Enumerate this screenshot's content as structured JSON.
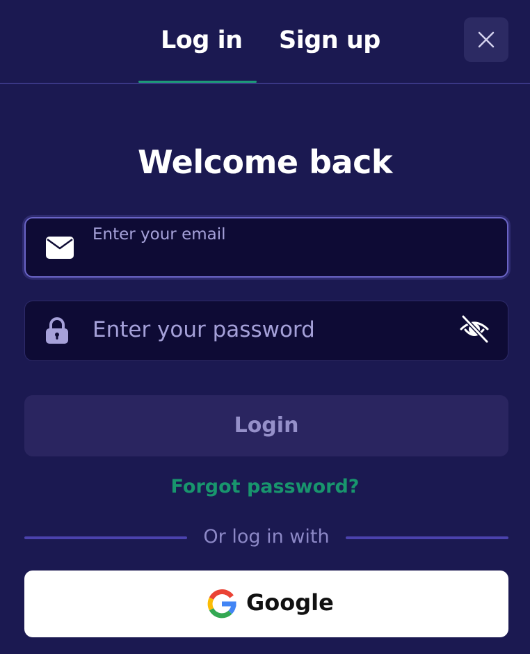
{
  "tabs": {
    "login": "Log in",
    "signup": "Sign up"
  },
  "close_icon": "close-icon",
  "title": "Welcome back",
  "email_field": {
    "icon": "envelope-icon",
    "placeholder": "Enter your email",
    "value": ""
  },
  "password_field": {
    "icon": "lock-icon",
    "placeholder": "Enter your password",
    "value": "",
    "toggle_icon": "eye-slash-icon"
  },
  "login_button": "Login",
  "forgot_link": "Forgot password?",
  "divider_text": "Or log in with",
  "google_button": {
    "icon": "google-icon",
    "label": "Google"
  },
  "colors": {
    "background": "#1b1951",
    "field_background": "#0e0b35",
    "accent_green": "#18956d",
    "tab_underline": "#1d9a78",
    "divider": "#4b42ad",
    "focus_border": "#6a64c6"
  }
}
